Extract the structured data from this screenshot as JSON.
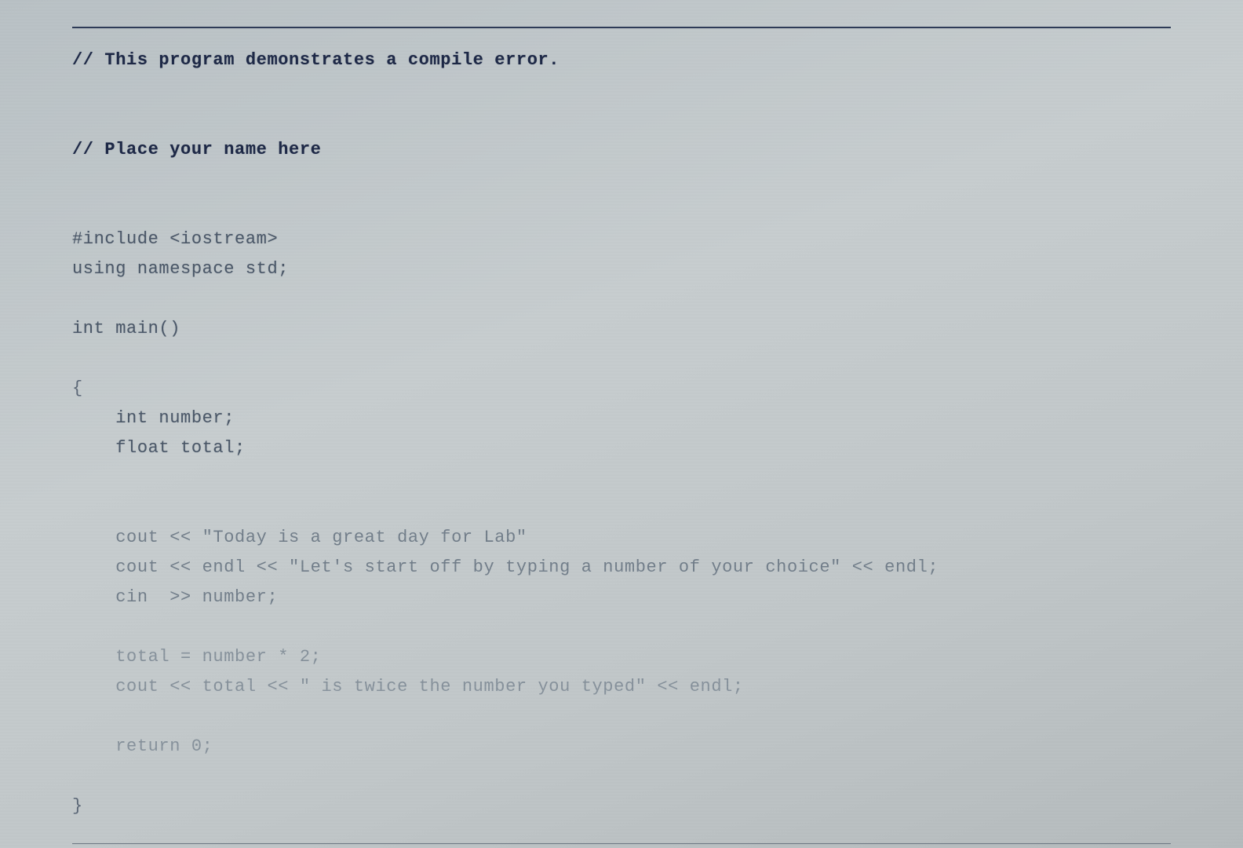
{
  "code": {
    "comment1": "// This program demonstrates a compile error.",
    "comment2": "// Place your name here",
    "include": "#include <iostream>",
    "using": "using namespace std;",
    "mainDecl": "int main()",
    "openBrace": "{",
    "declNumber": "    int number;",
    "declTotal": "    float total;",
    "cout1": "    cout << \"Today is a great day for Lab\"",
    "cout2": "    cout << endl << \"Let's start off by typing a number of your choice\" << endl;",
    "cin": "    cin  >> number;",
    "assign": "    total = number * 2;",
    "cout3": "    cout << total << \" is twice the number you typed\" << endl;",
    "ret": "    return 0;",
    "closeBrace": "}"
  }
}
